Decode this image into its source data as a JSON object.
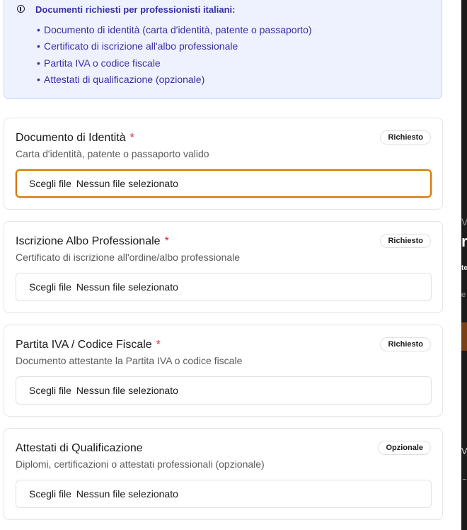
{
  "alert": {
    "icon": "alert-circle-icon",
    "title": "Documenti richiesti per professionisti italiani:",
    "items": [
      "Documento di identità (carta d'identità, patente o passaporto)",
      "Certificato di iscrizione all'albo professionale",
      "Partita IVA o codice fiscale",
      "Attestati di qualificazione (opzionale)"
    ]
  },
  "documents": [
    {
      "title": "Documento di Identità",
      "required_mark": "*",
      "badge": "Richiesto",
      "description": "Carta d'identità, patente o passaporto valido",
      "file_button": "Scegli file",
      "file_status": "Nessun file selezionato"
    },
    {
      "title": "Iscrizione Albo Professionale",
      "required_mark": "*",
      "badge": "Richiesto",
      "description": "Certificato di iscrizione all'ordine/albo professionale",
      "file_button": "Scegli file",
      "file_status": "Nessun file selezionato"
    },
    {
      "title": "Partita IVA / Codice Fiscale",
      "required_mark": "*",
      "badge": "Richiesto",
      "description": "Documento attestante la Partita IVA o codice fiscale",
      "file_button": "Scegli file",
      "file_status": "Nessun file selezionato"
    },
    {
      "title": "Attestati di Qualificazione",
      "badge": "Opzionale",
      "description": "Diplomi, certificazioni o attestati professionali (opzionale)",
      "file_button": "Scegli file",
      "file_status": "Nessun file selezionato"
    }
  ],
  "background_fragments": [
    "V",
    "r",
    "te",
    "e",
    "Vi"
  ],
  "colors": {
    "accent_text": "#3730a3",
    "alert_bg": "#eef2ff",
    "required": "#dc2626",
    "focus_ring": "#d97706"
  }
}
